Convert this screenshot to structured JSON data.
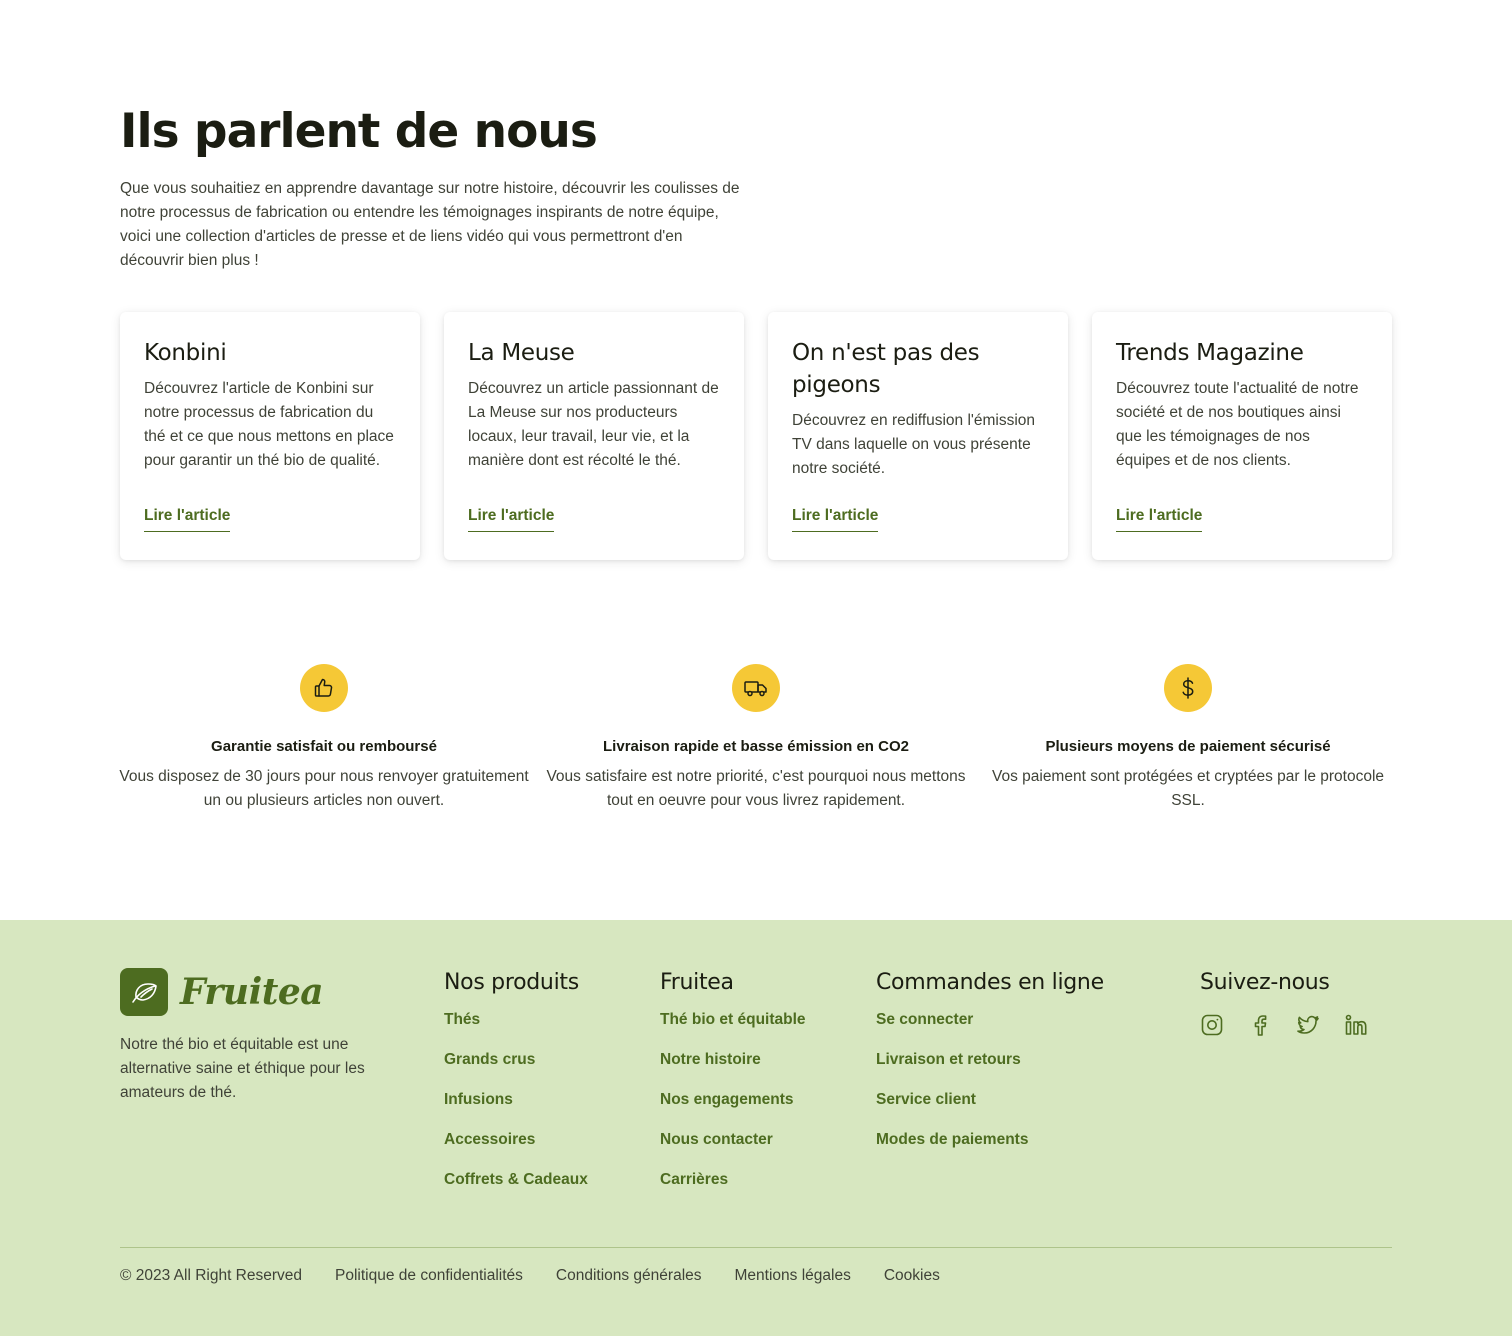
{
  "press": {
    "title": "Ils parlent de nous",
    "intro": "Que vous souhaitiez en apprendre davantage sur notre histoire, découvrir les coulisses de notre processus de fabrication ou entendre les témoignages inspirants de notre équipe, voici une collection d'articles de presse et de liens vidéo qui vous permettront d'en découvrir bien plus !",
    "cards": [
      {
        "title": "Konbini",
        "text": "Découvrez l'article de Konbini sur notre processus de fabrication du thé et ce que nous mettons en place pour garantir un thé bio de qualité.",
        "link": "Lire l'article"
      },
      {
        "title": "La Meuse",
        "text": "Découvrez un article passionnant de La Meuse sur nos producteurs locaux, leur travail, leur vie, et la manière dont est récolté le thé.",
        "link": "Lire l'article"
      },
      {
        "title": "On n'est pas des pigeons",
        "text": "Découvrez en rediffusion l'émission TV dans laquelle on vous présente notre société.",
        "link": "Lire l'article"
      },
      {
        "title": "Trends Magazine",
        "text": "Découvrez toute l'actualité de notre société et de nos boutiques ainsi que les témoignages de nos équipes et de nos clients.",
        "link": "Lire l'article"
      }
    ]
  },
  "features": [
    {
      "icon": "thumbs-up-icon",
      "title": "Garantie satisfait ou remboursé",
      "text": "Vous disposez de 30 jours pour nous renvoyer gratuitement un ou plusieurs articles non ouvert."
    },
    {
      "icon": "truck-icon",
      "title": "Livraison rapide et basse émission en CO2",
      "text": "Vous satisfaire est notre priorité, c'est pourquoi nous mettons tout en oeuvre pour vous livrez rapidement."
    },
    {
      "icon": "dollar-icon",
      "title": "Plusieurs moyens de paiement sécurisé",
      "text": "Vos paiement sont protégées et cryptées par le protocole SSL."
    }
  ],
  "footer": {
    "brand": "Fruitea",
    "about": "Notre thé bio et équitable est une alternative saine et éthique pour les amateurs de thé.",
    "products": {
      "title": "Nos produits",
      "items": [
        "Thés",
        "Grands crus",
        "Infusions",
        "Accessoires",
        "Coffrets & Cadeaux"
      ]
    },
    "company": {
      "title": "Fruitea",
      "items": [
        "Thé bio et équitable",
        "Notre histoire",
        "Nos engagements",
        "Nous contacter",
        "Carrières"
      ]
    },
    "orders": {
      "title": "Commandes en ligne",
      "items": [
        "Se connecter",
        "Livraison et retours",
        "Service client",
        "Modes de paiements"
      ]
    },
    "social": {
      "title": "Suivez-nous",
      "icons": [
        "instagram-icon",
        "facebook-icon",
        "twitter-icon",
        "linkedin-icon"
      ]
    },
    "copyright": "© 2023 All Right Reserved",
    "legal": [
      "Politique de confidentialités",
      "Conditions générales",
      "Mentions légales",
      "Cookies"
    ]
  },
  "colors": {
    "accent": "#4d6c20",
    "footer_bg": "#d7e7c0",
    "feature_bubble": "#f5c836"
  }
}
